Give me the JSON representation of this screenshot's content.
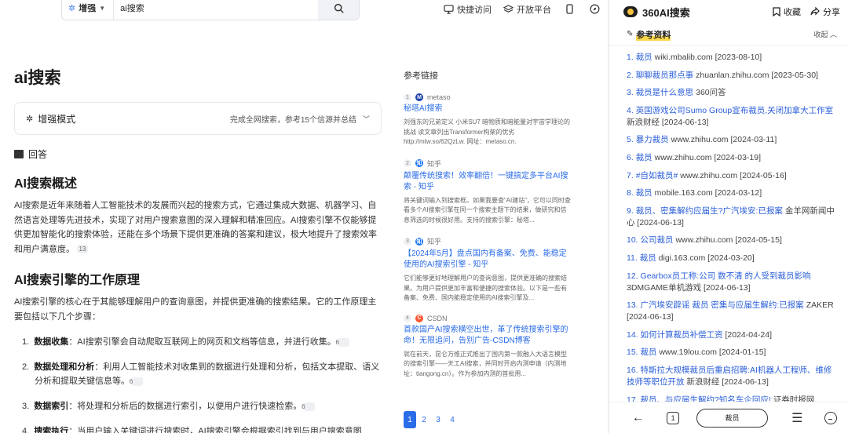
{
  "topbar": {
    "mode": "增强",
    "query": "ai搜索",
    "quick_access": "快捷访问",
    "open_platform": "开放平台"
  },
  "main": {
    "title": "ai搜索",
    "mode_card": {
      "label": "增强模式",
      "status": "完成全网搜索，参考15个信源并总结"
    },
    "answer_label": "回答",
    "section1": {
      "heading": "AI搜索概述",
      "text": "AI搜索是近年来随着人工智能技术的发展而兴起的搜索方式，它通过集成大数据、机器学习、自然语言处理等先进技术，实现了对用户搜索意图的深入理解和精准回应。AI搜索引擎不仅能够提供更加智能化的搜索体验，还能在多个场景下提供更准确的答案和建议，极大地提升了搜索效率和用户满意度。",
      "ref": "13"
    },
    "section2": {
      "heading": "AI搜索引擎的工作原理",
      "intro": "AI搜索引擎的核心在于其能够理解用户的查询意图，并提供更准确的搜索结果。它的工作原理主要包括以下几个步骤：",
      "steps": [
        {
          "num": "1.",
          "title": "数据收集",
          "text": "：AI搜索引擎会自动爬取互联网上的网页和文档等信息，并进行收集。",
          "ref": "6"
        },
        {
          "num": "2.",
          "title": "数据处理和分析",
          "text": "：利用人工智能技术对收集到的数据进行处理和分析，包括文本提取、语义分析和提取关键信息等。",
          "ref": "6"
        },
        {
          "num": "3.",
          "title": "数据索引",
          "text": "：将处理和分析后的数据进行索引，以便用户进行快速检索。",
          "ref": "6"
        },
        {
          "num": "4.",
          "title": "搜索执行",
          "text": "：当用户输入关键词进行搜索时，AI搜索引擎会根据索引找到与用户搜索意图",
          "ref": ""
        }
      ]
    }
  },
  "references": {
    "title": "参考链接",
    "items": [
      {
        "num": "1",
        "source": "metaso",
        "source_color": "#1d3fa8",
        "source_glyph": "M",
        "title": "秘塔AI搜索",
        "snippet": "刘强东的兄弟定义 小米SU7 暗物质和暗能量对宇宙学理论的挑战 读文章列出Transformer构架的优劣 http://mtw.so/62QzLw. 网址：metaso.cn."
      },
      {
        "num": "2",
        "source": "知乎",
        "source_color": "#1772f6",
        "source_glyph": "知",
        "title": "颠覆传统搜索！效率翻倍！一键搞定多平台AI搜索 - 知乎",
        "snippet": "将关键词输入到搜索框。如果我要查“AI建站”，它可以同时查看多个AI搜索引擎在同一个搜索主题下的结果，做研究和信息筛选的时候很好用。支持的搜索引擎：秘塔..."
      },
      {
        "num": "3",
        "source": "知乎",
        "source_color": "#1772f6",
        "source_glyph": "知",
        "title": "【2024年5月】盘点国内有备案、免费、能稳定使用的AI搜索引擎 - 知乎",
        "snippet": "它们能够更好地理解用户的查询意图，提供更准确的搜索结果。为用户提供更加丰富和便捷的搜索体验。以下是一些有备案、免费、国内能稳定使用的AI搜索引擎及..."
      },
      {
        "num": "4",
        "source": "CSDN",
        "source_color": "#fc5531",
        "source_glyph": "C",
        "title": "首款国产AI搜索横空出世，革了传统搜索引擎的命！无限追问，告别广告-CSDN博客",
        "snippet": "就在前天，昆仑万维正式推出了国内第一款融入大语言模型的搜索引擎——天工AI搜索，并同时开启内测申请（内测地址：tiangong.cn）。作为参加内测的首批用..."
      }
    ],
    "pages": [
      "1",
      "2",
      "3",
      "4"
    ],
    "active_page": "1"
  },
  "sidepanel": {
    "brand": "360AI搜索",
    "bookmark": "收藏",
    "share": "分享",
    "refs_title": "参考资料",
    "collapse": "收起",
    "items": [
      {
        "num": "1.",
        "title": "裁员",
        "meta": "wiki.mbalib.com [2023-08-10]"
      },
      {
        "num": "2.",
        "title": "聊聊裁员那点事",
        "meta": "zhuanlan.zhihu.com [2023-05-30]"
      },
      {
        "num": "3.",
        "title": "裁员是什么意思",
        "meta": "360问答"
      },
      {
        "num": "4.",
        "title": "英国游戏公司Sumo Group宣布裁员,关闭加拿大工作室",
        "meta": "新浪财经 [2024-06-13]"
      },
      {
        "num": "5.",
        "title": "暴力裁员",
        "meta": "www.zhihu.com [2024-03-11]"
      },
      {
        "num": "6.",
        "title": "裁员",
        "meta": "www.zhihu.com [2024-03-19]"
      },
      {
        "num": "7.",
        "title": "#自如裁员#",
        "meta": "www.zhihu.com [2024-05-16]"
      },
      {
        "num": "8.",
        "title": "裁员",
        "meta": "mobile.163.com [2024-03-12]"
      },
      {
        "num": "9.",
        "title": "裁员、密集解约应届生?广汽埃安:已报案",
        "meta": "金羊网新闻中心 [2024-06-13]"
      },
      {
        "num": "10.",
        "title": "公司裁员",
        "meta": "www.zhihu.com [2024-05-15]"
      },
      {
        "num": "11.",
        "title": "裁员",
        "meta": "digi.163.com [2024-03-20]"
      },
      {
        "num": "12.",
        "title": "Gearbox员工称:公司 数不清 的人受到裁员影响",
        "meta": "3DMGAME单机游戏 [2024-06-13]"
      },
      {
        "num": "13.",
        "title": "广汽埃安辟谣 裁员 密集与应届生解约:已报案",
        "meta": "ZAKER [2024-06-13]"
      },
      {
        "num": "14.",
        "title": "如何计算裁员补偿工资",
        "meta": "[2024-04-24]"
      },
      {
        "num": "15.",
        "title": "裁员",
        "meta": "www.19lou.com [2024-01-15]"
      },
      {
        "num": "16.",
        "title": "特斯拉大规模裁员后重启招聘:AI机器人工程师、维修技师等职位开放",
        "meta": "新浪财经 [2024-06-13]"
      },
      {
        "num": "17.",
        "title": "裁员、与应届生解约?知名车企回应!",
        "meta": "证券时报网 [2024-06-13]"
      }
    ],
    "bottom": {
      "tabs_count": "1",
      "search_label": "裁员"
    }
  },
  "colors": {
    "accent": "#2b6de8",
    "highlight": "#ffd84d"
  }
}
